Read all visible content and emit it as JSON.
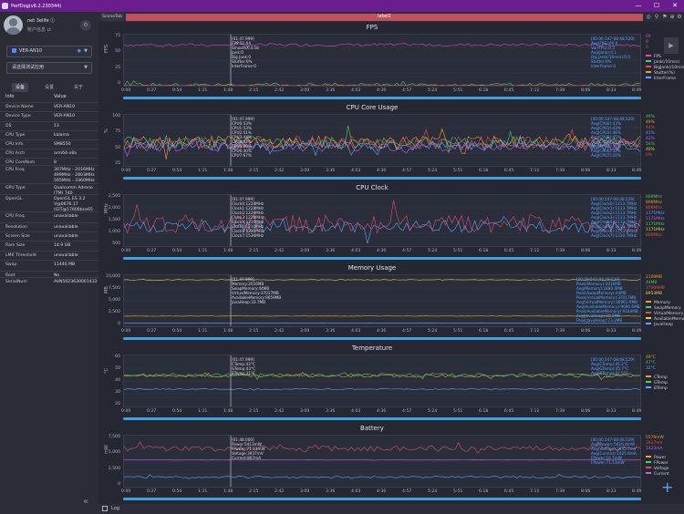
{
  "window": {
    "title": "PerfDog(v6.2.230344)",
    "controls": [
      "—",
      "☐",
      "✕"
    ]
  },
  "sidebar": {
    "user_name": "net 3elife ⓘ",
    "account_label": "账户信息 ⇄",
    "device_select": "VER-AN10",
    "app_select": "请选择测试应用",
    "tabs": [
      "设备",
      "设置",
      "关于"
    ],
    "info_header": {
      "key": "Info",
      "value": "Value"
    },
    "info_rows": [
      {
        "k": "Device Name",
        "v": "VER-AN10",
        "h": 10
      },
      {
        "k": "Device Type",
        "v": "VER-AN10",
        "h": 11
      },
      {
        "k": "OS",
        "v": "13",
        "h": 10
      },
      {
        "k": "CPU Type",
        "v": "kalama",
        "h": 10
      },
      {
        "k": "CPU Info",
        "v": "SM8550",
        "h": 10
      },
      {
        "k": "CPU Arch",
        "v": "arm64-v8a",
        "h": 10
      },
      {
        "k": "CPU CoreNum",
        "v": "8",
        "h": 8
      },
      {
        "k": "CPU Freq",
        "v": "307MHz - 2016MHz\n499MHz - 2803MHz\n595MHz - 3360MHz",
        "h": 20
      },
      {
        "k": "GPU Type",
        "v": "Qualcomm Adreno\n(TM) 740",
        "h": 12
      },
      {
        "k": "OpenGL",
        "v": "OpenGL ES 3.2\nV@0676.17\n(GIT@17600bce65",
        "h": 19
      },
      {
        "k": "CPU Freq",
        "v": "unavailable",
        "h": 12
      },
      {
        "k": "Resolution",
        "v": "unavailable",
        "h": 10
      },
      {
        "k": "Screen Size",
        "v": "unavailable",
        "h": 10
      },
      {
        "k": "Ram Size",
        "v": "14.9 GB",
        "h": 11
      },
      {
        "k": "LMK Threshold",
        "v": "unavailable",
        "h": 10
      },
      {
        "k": "Swap",
        "v": "11446 MB",
        "h": 12
      },
      {
        "k": "Root",
        "v": "No",
        "h": 7
      },
      {
        "k": "SerialNum",
        "v": "AVN5023630001433",
        "h": 10
      }
    ]
  },
  "toolbar": {
    "scene_tab": "SceneTab",
    "label": "label1",
    "icons": [
      "location-icon",
      "pin-icon",
      "flag-icon",
      "add-icon",
      "gear-icon"
    ]
  },
  "x_ticks": [
    "0:00",
    "0:27",
    "0:54",
    "1:21",
    "1:48",
    "2:15",
    "2:42",
    "3:09",
    "3:36",
    "4:03",
    "4:30",
    "4:57",
    "5:24",
    "5:51",
    "6:18",
    "6:45",
    "7:12",
    "7:39",
    "8:06",
    "8:33",
    "8:49"
  ],
  "chart_data": [
    {
      "type": "line",
      "title": "FPS",
      "ylabel": "FPS",
      "ylim": [
        0,
        75
      ],
      "yticks": [
        "75",
        "50",
        "25",
        "0"
      ],
      "cursor": "[01:47.999]\nFPS:51.64\nSmoothX:4.58\nJank:0\nBig Jank:0\nStutter:0%\nInterFrame:0",
      "stats": "[00:00.547-08:48.529]\nAvg(FPS):60.0\nVar(FPS):0.3\nAvg(Jank):0.1\nBig Jank(/10min):0.0\nStutter:0%\nInterFrame:0",
      "right_values": [
        {
          "t": "60",
          "c": "#e04ac0"
        },
        {
          "t": "0",
          "c": "#4ad35a"
        },
        {
          "t": "0",
          "c": "#e05050"
        }
      ],
      "legend": [
        {
          "name": "FPS",
          "c": "#e04ac0"
        },
        {
          "name": "Jank(/10min)",
          "c": "#4ad35a"
        },
        {
          "name": "BigJank(/10min)",
          "c": "#e05050"
        },
        {
          "name": "Stutter(%)",
          "c": "#f0a030"
        },
        {
          "name": "InterFrame",
          "c": "#5aa8ff"
        }
      ],
      "series": [
        {
          "name": "FPS",
          "color": "#e04ac0",
          "base": 60,
          "noise": 2
        },
        {
          "name": "Jank(/10min)",
          "color": "#4ad35a",
          "base": 1,
          "noise": 3
        },
        {
          "name": "BigJank(/10min)",
          "color": "#e05050",
          "base": 0.5,
          "noise": 1
        }
      ]
    },
    {
      "type": "line",
      "title": "CPU Core Usage",
      "ylabel": "%",
      "ylim": [
        0,
        100
      ],
      "yticks": [
        "100",
        "75",
        "50",
        "25"
      ],
      "cursor": "[01:47.999]\nCPU0:53%\nCPU1:53%\nCPU2:51%\nCPU3:44%\nCPU4:42%\nCPU5:60%\nCPU6:40%\nCPU7:67%",
      "stats": "[00:00.547-08:48.529]\nAvg(CPU0):43%\nAvg(CPU1):43%\nAvg(CPU2):46%\nAvg(CPU3):45%\nAvg(CPU4):37%\nAvg(CPU5):37%\nAvg(CPU6):32%\nAvg(CPU7):20%",
      "right_values": [
        {
          "t": "49%",
          "c": "#4ad35a"
        },
        {
          "t": "49%",
          "c": "#f0a030"
        },
        {
          "t": "44%",
          "c": "#e05050"
        },
        {
          "t": "41%",
          "c": "#5aa8ff"
        },
        {
          "t": "42%",
          "c": "#c060f0"
        },
        {
          "t": "54%",
          "c": "#4ad35a"
        },
        {
          "t": "40%",
          "c": "#f0d040"
        },
        {
          "t": "0%",
          "c": "#e05050"
        }
      ],
      "legend": [],
      "series": [
        {
          "name": "CPU0",
          "color": "#4ad35a",
          "base": 45,
          "noise": 12
        },
        {
          "name": "CPU1",
          "color": "#f0a030",
          "base": 47,
          "noise": 12
        },
        {
          "name": "CPU2",
          "color": "#e05050",
          "base": 46,
          "noise": 12
        },
        {
          "name": "CPU3",
          "color": "#5aa8ff",
          "base": 40,
          "noise": 10
        },
        {
          "name": "CPU4",
          "color": "#c060f0",
          "base": 38,
          "noise": 10
        }
      ]
    },
    {
      "type": "line",
      "title": "CPU Clock",
      "ylabel": "MHz",
      "ylim": [
        0,
        3000
      ],
      "yticks": [
        "2,500",
        "2,000",
        "1,500",
        "1,000",
        "500"
      ],
      "cursor": "[01:47.999]\nClock0:1228MHz\nClock1:1228MHz\nClock2:1228MHz\nClock3:1228MHz\nClock4:1210MHz\nClock5:1210MHz\nClock6:1210MHz\nClock7:1536MHz",
      "stats": "[00:00.547-08:48.529]\nAvg(Clock0):1113.7MHz\nAvg(Clock1):1113.7MHz\nAvg(Clock2):1113.7MHz\nAvg(Clock3):1113.7MHz\nAvg(Clock4):1113.7MHz\nAvg(Clock5):1113.7MHz\nAvg(Clock6):1113.7MHz\nAvg(Clock7):1310.7MHz",
      "right_values": [
        {
          "t": "806MHz",
          "c": "#4ad35a"
        },
        {
          "t": "806MHz",
          "c": "#f0a030"
        },
        {
          "t": "806MHz",
          "c": "#e05050"
        },
        {
          "t": "1171MHz",
          "c": "#5aa8ff"
        },
        {
          "t": "1171MHz",
          "c": "#c060f0"
        },
        {
          "t": "1171MHz",
          "c": "#4ad35a"
        },
        {
          "t": "1171MHz",
          "c": "#f0d040"
        },
        {
          "t": "806MHz",
          "c": "#e05050"
        }
      ],
      "legend": [],
      "series": [
        {
          "name": "Clock0",
          "color": "#5aa8ff",
          "base": 1150,
          "noise": 350
        },
        {
          "name": "Clock7",
          "color": "#e05070",
          "base": 1300,
          "noise": 550
        }
      ]
    },
    {
      "type": "line",
      "title": "Memory Usage",
      "ylabel": "MB",
      "ylim": [
        0,
        10000
      ],
      "yticks": [
        "10,000",
        "7,500",
        "5,000",
        "2,500",
        "0"
      ],
      "cursor": "[01:47.999]\nMemory:2016MB\nSwapMemory:44MB\nVirtualMemory:37017MB\nAvailableMemory:9059MB\nJavaHeap:33.7MB",
      "stats": "[00:00.547-08:48.529]\nPeak(Memory):2016MB\nAvg(Memory):1880.0MB\nPeak(SwapMemory):44MB\nPeak(VirtualMemory):37017MB\nAvg(VirtualMemory):36961.9MB\nAvg(AvailableMemory):9090.6MB\nPeak(AvailableMemory):9184MB\nAvg(JavaHeap):30.5MB\nPeak(JavaHeap):73.2MB",
      "right_values": [
        {
          "t": "2109MB",
          "c": "#f0a030"
        },
        {
          "t": "44MB",
          "c": "#4ad35a"
        },
        {
          "t": "37009MB",
          "c": "#e05050"
        },
        {
          "t": "8953MB",
          "c": "#f0d040"
        }
      ],
      "legend": [
        {
          "name": "Memory",
          "c": "#f0a030"
        },
        {
          "name": "SwapMemory",
          "c": "#4ad35a"
        },
        {
          "name": "VirtualMemory",
          "c": "#e05050"
        },
        {
          "name": "AvailableMemory",
          "c": "#f0d040"
        },
        {
          "name": "JavaHeap",
          "c": "#5aa8ff"
        }
      ],
      "series": [
        {
          "name": "AvailableMemory",
          "color": "#d8d040",
          "base": 9100,
          "noise": 60
        },
        {
          "name": "Memory",
          "color": "#f0a030",
          "base": 2000,
          "noise": 30
        },
        {
          "name": "JavaHeap",
          "color": "#5aa8ff",
          "base": 600,
          "noise": 10
        }
      ]
    },
    {
      "type": "line",
      "title": "Temperature",
      "ylabel": "°C",
      "ylim": [
        15,
        65
      ],
      "yticks": [
        "60",
        "50",
        "40",
        "30",
        "20"
      ],
      "cursor": "[01:47.999]\nCTemp:43°C\nGTemp:43°C\nBTemp:31°C",
      "stats": "[00:00.547-08:48.529]\nAvg(CTemp):45.2°C\nAvg(GTemp):45.7°C\nAvg(BTemp):32.5°C",
      "right_values": [
        {
          "t": "49°C",
          "c": "#f0a030"
        },
        {
          "t": "47°C",
          "c": "#4ad35a"
        },
        {
          "t": "32°C",
          "c": "#5aa8ff"
        }
      ],
      "legend": [
        {
          "name": "CTemp",
          "c": "#f0a030"
        },
        {
          "name": "GTemp",
          "c": "#4ad35a"
        },
        {
          "name": "BTemp",
          "c": "#5aa8ff"
        }
      ],
      "series": [
        {
          "name": "CTemp",
          "color": "#f0a030",
          "base": 45,
          "noise": 1.5
        },
        {
          "name": "GTemp",
          "color": "#4ad35a",
          "base": 46,
          "noise": 1.5
        },
        {
          "name": "BTemp",
          "color": "#5aa8ff",
          "base": 32,
          "noise": 0.5
        }
      ]
    },
    {
      "type": "line",
      "title": "Battery",
      "ylabel": "mW",
      "ylim": [
        0,
        7500
      ],
      "yticks": [
        "7,500",
        "5,000",
        "2,500",
        "0"
      ],
      "cursor": "[01:48.000]\nPower:5413mW\nFPower:71.13mW\nVoltage:3937mV\nCurrent:867mA",
      "stats": "[00:00.547-08:48.529]\nAvg(Power):5616.4mW\nAvg(Voltage):3935.7mV\nAvg(Current):1425.6mA\nFPower:16.7mW\nFPower:71.13mW",
      "right_values": [
        {
          "t": "5579mW",
          "c": "#f0a030"
        },
        {
          "t": "3927mV",
          "c": "#e05050"
        },
        {
          "t": "1423mA",
          "c": "#c060f0"
        }
      ],
      "legend": [
        {
          "name": "Power",
          "c": "#f0a030"
        },
        {
          "name": "FPower",
          "c": "#4ad35a"
        },
        {
          "name": "Voltage",
          "c": "#e05050"
        },
        {
          "name": "Current",
          "c": "#c060f0"
        }
      ],
      "series": [
        {
          "name": "Power",
          "color": "#e05070",
          "base": 5600,
          "noise": 400
        },
        {
          "name": "Voltage",
          "color": "#c060f0",
          "base": 3930,
          "noise": 20
        },
        {
          "name": "Current",
          "color": "#5aa8ff",
          "base": 1420,
          "noise": 150
        }
      ]
    }
  ],
  "bottom": {
    "log_label": "Log",
    "add_icon": "+"
  }
}
